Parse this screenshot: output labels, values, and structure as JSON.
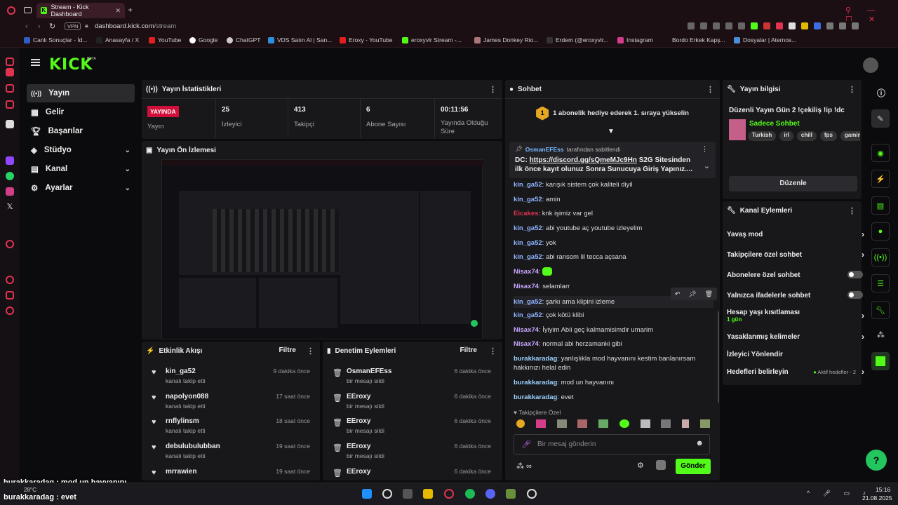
{
  "browser": {
    "tab_title": "Stream - Kick Dashboard",
    "address_domain": "dashboard.kick.com",
    "address_path": "/stream",
    "vpn_label": "VPN",
    "bookmarks": [
      "Canlı Sonuçlar - İd...",
      "Anasayfa / X",
      "YouTube",
      "Google",
      "ChatGPT",
      "VDS Satın Al | San...",
      "Eroxy - YouTube",
      "eroxyvlr Stream -...",
      "James Donkey Rio...",
      "Erdem (@eroxyvlr...",
      "Instagram",
      "Bordo Erkek Kapş...",
      "Dosyalar | Aternos..."
    ]
  },
  "app": {
    "logo": "KICK",
    "beta": "BETA"
  },
  "nav": {
    "items": [
      {
        "label": "Yayın",
        "icon": "broadcast-icon"
      },
      {
        "label": "Gelir",
        "icon": "income-icon"
      },
      {
        "label": "Başarılar",
        "icon": "trophy-icon"
      },
      {
        "label": "Stüdyo",
        "icon": "studio-icon"
      },
      {
        "label": "Kanal",
        "icon": "channel-icon"
      },
      {
        "label": "Ayarlar",
        "icon": "gear-icon"
      }
    ]
  },
  "stats": {
    "title": "Yayın İstatistikleri",
    "live_badge": "YAYINDA",
    "live_label": "Yayın",
    "viewers_value": "25",
    "viewers_label": "İzleyici",
    "followers_value": "413",
    "followers_label": "Takipçi",
    "subs_value": "6",
    "subs_label": "Abone Sayısı",
    "duration_value": "00:11:56",
    "duration_label": "Yayında Olduğu Süre"
  },
  "preview": {
    "title": "Yayın Ön İzlemesi"
  },
  "activity": {
    "title": "Etkinlik Akışı",
    "filter": "Filtre",
    "items": [
      {
        "name": "kin_ga52",
        "sub": "kanalı takip etti",
        "time": "9 dakika önce"
      },
      {
        "name": "napolyon088",
        "sub": "kanalı takip etti",
        "time": "17 saat önce"
      },
      {
        "name": "rnflylinsm",
        "sub": "kanalı takip etti",
        "time": "18 saat önce"
      },
      {
        "name": "debulubulubban",
        "sub": "kanalı takip etti",
        "time": "19 saat önce"
      },
      {
        "name": "mrrawien",
        "sub": "",
        "time": "19 saat önce"
      }
    ]
  },
  "moderation": {
    "title": "Denetim Eylemleri",
    "filter": "Filtre",
    "items": [
      {
        "name": "OsmanEFEss",
        "sub": "bir mesajı sildi",
        "time": "6 dakika önce"
      },
      {
        "name": "EEroxy",
        "sub": "bir mesajı sildi",
        "time": "6 dakika önce"
      },
      {
        "name": "EEroxy",
        "sub": "bir mesajı sildi",
        "time": "6 dakika önce"
      },
      {
        "name": "EEroxy",
        "sub": "bir mesajı sildi",
        "time": "6 dakika önce"
      },
      {
        "name": "EEroxy",
        "sub": "",
        "time": "6 dakika önce"
      }
    ]
  },
  "chat": {
    "title": "Sohbet",
    "gift_banner": "1 abonelik hediye ederek 1. sıraya yükselin",
    "gift_number": "1",
    "pinned_by": "OsmanEFEss",
    "pinned_suffix": "tarafından sabitlendi",
    "pinned_prefix": "DC:",
    "pinned_link": "https://discord.gg/sQmeMJc9Hn",
    "pinned_rest": "S2G Sitesinden ilk önce kayıt olunuz Sonra Sunucuya Giriş Yapınız....",
    "messages": [
      {
        "user": "kin_ga52",
        "text": "karışık sistem çok kaliteli diyil",
        "color": "#8fb4ff"
      },
      {
        "user": "kin_ga52",
        "text": "amin",
        "color": "#8fb4ff"
      },
      {
        "user": "Eicakes",
        "text": "knk işimiz var gel",
        "color": "#e0334f"
      },
      {
        "user": "kin_ga52",
        "text": "abi youtube aç youtube izleyelim",
        "color": "#8fb4ff"
      },
      {
        "user": "kin_ga52",
        "text": "yok",
        "color": "#8fb4ff"
      },
      {
        "user": "kin_ga52",
        "text": "abi ransom lil tecca açsana",
        "color": "#8fb4ff"
      },
      {
        "user": "Nisax74",
        "text": "",
        "color": "#c9a6ff"
      },
      {
        "user": "Nisax74",
        "text": "selamlarr",
        "color": "#c9a6ff"
      },
      {
        "user": "kin_ga52",
        "text": "şarkı ama klipini izleme",
        "color": "#8fb4ff"
      },
      {
        "user": "kin_ga52",
        "text": "çok kötü klibi",
        "color": "#8fb4ff"
      },
      {
        "user": "Nisax74",
        "text": "İyiyim Abii geç kalmamisimdir umarim",
        "color": "#c9a6ff"
      },
      {
        "user": "Nisax74",
        "text": "normal abi herzamanki gibi",
        "color": "#c9a6ff"
      },
      {
        "user": "burakkaradag",
        "text": "yanlışlıkla mod hayvanını kestim banlanırsam hakkınızı helal edin",
        "color": "#9bd2ff"
      },
      {
        "user": "burakkaradag",
        "text": "mod un hayvanını",
        "color": "#9bd2ff"
      },
      {
        "user": "burakkaradag",
        "text": "evet",
        "color": "#9bd2ff"
      }
    ],
    "followers_only_label": "Takipçilere Özel",
    "input_placeholder": "Bir mesaj gönderin",
    "send_label": "Gönder"
  },
  "stream_info": {
    "title": "Yayın bilgisi",
    "stream_title": "Düzenli Yayın Gün 2 !çekiliş !ip !dc",
    "category": "Sadece Sohbet",
    "tags": [
      "Turkish",
      "irl",
      "chill",
      "fps",
      "gamin"
    ],
    "edit_label": "Düzenle"
  },
  "channel_actions": {
    "title": "Kanal Eylemleri",
    "items": [
      {
        "label": "Yavaş mod",
        "kind": "chevron"
      },
      {
        "label": "Takipçilere özel sohbet",
        "kind": "chevron"
      },
      {
        "label": "Abonelere özel sohbet",
        "kind": "toggle"
      },
      {
        "label": "Yalnızca ifadelerle sohbet",
        "kind": "toggle"
      },
      {
        "label": "Hesap yaşı kısıtlaması",
        "kind": "chevron",
        "sub": "1 gün"
      },
      {
        "label": "Yasaklanmış kelimeler",
        "kind": "chevron"
      },
      {
        "label": "İzleyici Yönlendir",
        "kind": "none"
      },
      {
        "label": "Hedefleri belirleyin",
        "kind": "chevron",
        "extra": "Aktif hedefler - 2"
      }
    ]
  },
  "overlay": {
    "line1": "burakkaradag : mod un hayvanını",
    "line2": "burakkaradag : evet"
  },
  "taskbar": {
    "weather": "28°C",
    "time": "15:16",
    "date": "21.08.2025"
  },
  "colors": {
    "accent": "#53fc18",
    "live": "#d0103a",
    "panel": "#18181b"
  }
}
